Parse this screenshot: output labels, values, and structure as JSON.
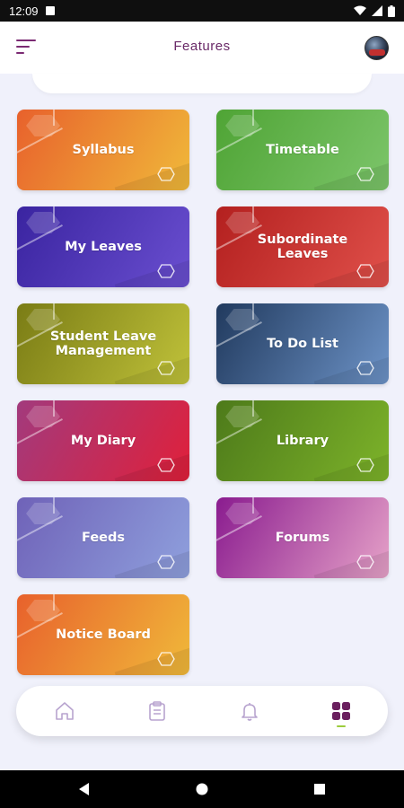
{
  "status_bar": {
    "time": "12:09"
  },
  "header": {
    "title": "Features"
  },
  "features": [
    {
      "label": "Syllabus",
      "grad_start": "#e8612c",
      "grad_end": "#f0b93a"
    },
    {
      "label": "Timetable",
      "grad_start": "#4fa435",
      "grad_end": "#7cc56a"
    },
    {
      "label": "My Leaves",
      "grad_start": "#3a24a0",
      "grad_end": "#6a4fd0"
    },
    {
      "label": "Subordinate Leaves",
      "grad_start": "#b3201f",
      "grad_end": "#e0504a"
    },
    {
      "label": "Student Leave Management",
      "grad_start": "#7a7c15",
      "grad_end": "#c0c23a"
    },
    {
      "label": "To Do List",
      "grad_start": "#213a5e",
      "grad_end": "#6d93c7"
    },
    {
      "label": "My Diary",
      "grad_start": "#a23a7d",
      "grad_end": "#e0203a"
    },
    {
      "label": "Library",
      "grad_start": "#4d7a1a",
      "grad_end": "#7db32a"
    },
    {
      "label": "Feeds",
      "grad_start": "#6f62b8",
      "grad_end": "#8fa0dd"
    },
    {
      "label": "Forums",
      "grad_start": "#8a1c8f",
      "grad_end": "#e6a2c8"
    },
    {
      "label": "Notice Board",
      "grad_start": "#e8612c",
      "grad_end": "#f0b93a"
    }
  ],
  "bottom_nav": {
    "items": [
      {
        "icon": "home-icon",
        "active": false
      },
      {
        "icon": "clipboard-icon",
        "active": false
      },
      {
        "icon": "bell-icon",
        "active": false
      },
      {
        "icon": "grid-icon",
        "active": true
      }
    ],
    "inactive_color": "#b8a4cf",
    "active_color": "#6a1f5e",
    "indicator_color": "#9ccc3c"
  },
  "colors": {
    "accent": "#7b2a73",
    "background": "#f0f1fb"
  }
}
